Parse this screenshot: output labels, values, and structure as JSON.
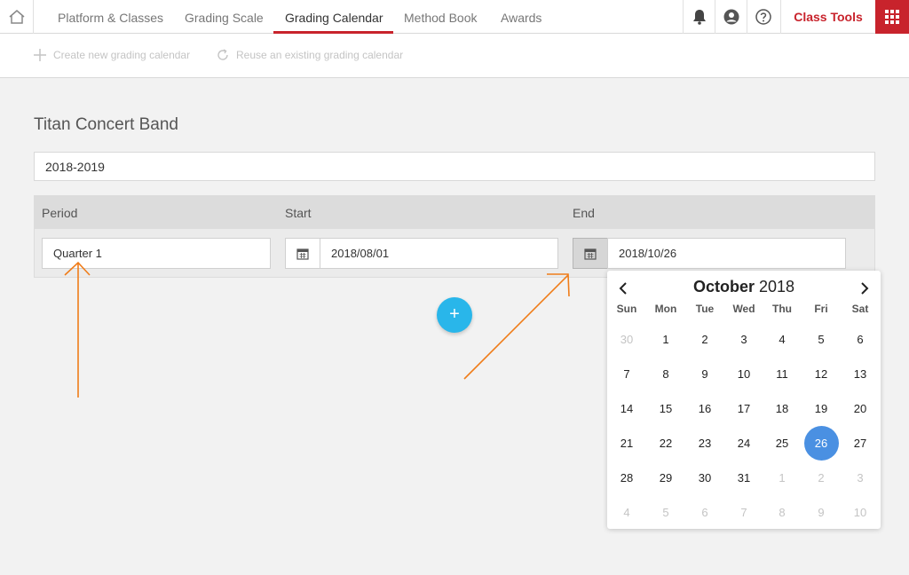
{
  "nav": {
    "tabs": [
      {
        "label": "Platform & Classes"
      },
      {
        "label": "Grading Scale"
      },
      {
        "label": "Grading Calendar"
      },
      {
        "label": "Method Book"
      },
      {
        "label": "Awards"
      }
    ],
    "active_tab": "Grading Calendar",
    "class_tools": "Class Tools",
    "accent_color": "#c8232c"
  },
  "toolbar": {
    "create_label": "Create new grading calendar",
    "reuse_label": "Reuse an existing grading calendar"
  },
  "page": {
    "title": "Titan Concert Band",
    "school_year": "2018-2019"
  },
  "table": {
    "headers": {
      "period": "Period",
      "start": "Start",
      "end": "End"
    },
    "row": {
      "period": "Quarter 1",
      "start": "2018/08/01",
      "end": "2018/10/26"
    }
  },
  "add_button": "+",
  "datepicker": {
    "month": "October",
    "year": "2018",
    "selected_day": "26",
    "selected_color": "#4a90e2",
    "weekdays": [
      "Sun",
      "Mon",
      "Tue",
      "Wed",
      "Thu",
      "Fri",
      "Sat"
    ],
    "weeks": [
      [
        "30",
        "1",
        "2",
        "3",
        "4",
        "5",
        "6"
      ],
      [
        "7",
        "8",
        "9",
        "10",
        "11",
        "12",
        "13"
      ],
      [
        "14",
        "15",
        "16",
        "17",
        "18",
        "19",
        "20"
      ],
      [
        "21",
        "22",
        "23",
        "24",
        "25",
        "26",
        "27"
      ],
      [
        "28",
        "29",
        "30",
        "31",
        "1",
        "2",
        "3"
      ],
      [
        "4",
        "5",
        "6",
        "7",
        "8",
        "9",
        "10"
      ]
    ]
  },
  "annotation_color": "#f07d1a"
}
